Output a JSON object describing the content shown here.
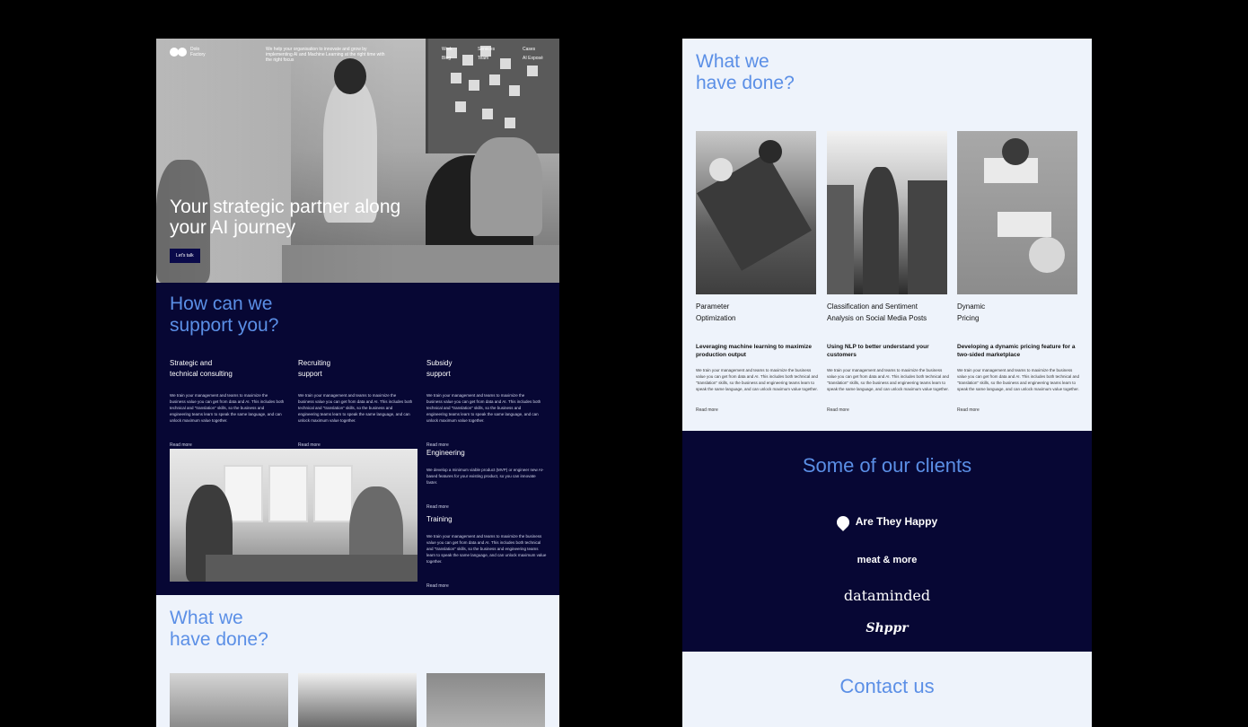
{
  "left": {
    "logo": {
      "line1": "Dolo",
      "line2": "Factory"
    },
    "hero": {
      "blurb": "We help your organisation to innovate and grow by implementing AI and Machine Learning at the right time with the right focus",
      "nav": [
        "Work",
        "Services",
        "Cases",
        "Blog",
        "Team",
        "AI Exposé"
      ],
      "title": "Your strategic partner along your AI journey",
      "cta": "Let's talk"
    },
    "support": {
      "title_l1": "How can we",
      "title_l2": "support you?",
      "services": [
        {
          "l1": "Strategic and",
          "l2": "technical consulting",
          "body": "We train your management and teams to maximize the business value you can get from data and AI. This includes both technical and \"translation\" skills, so the business and engineering teams learn to speak the same language, and can unlock maximum value together.",
          "more": "Read more"
        },
        {
          "l1": "Recruiting",
          "l2": "support",
          "body": "We train your management and teams to maximize the business value you can get from data and AI. This includes both technical and \"translation\" skills, so the business and engineering teams learn to speak the same language, and can unlock maximum value together.",
          "more": "Read more"
        },
        {
          "l1": "Subsidy",
          "l2": "support",
          "body": "We train your management and teams to maximize the business value you can get from data and AI. This includes both technical and \"translation\" skills, so the business and engineering teams learn to speak the same language, and can unlock maximum value together.",
          "more": "Read more"
        }
      ],
      "engineering": {
        "title": "Engineering",
        "body": "We develop a minimum viable product (MVP) or engineer new AI-based features for your existing product, so you can innovate faster.",
        "more": "Read more"
      },
      "training": {
        "title": "Training",
        "body": "We train your management and teams to maximize the business value you can get from data and AI. This includes both technical and \"translation\" skills, so the business and engineering teams learn to speak the same language, and can unlock maximum value together.",
        "more": "Read more"
      }
    },
    "done": {
      "title_l1": "What we",
      "title_l2": "have done?"
    }
  },
  "right": {
    "done": {
      "title_l1": "What we",
      "title_l2": "have done?",
      "cards": [
        {
          "t1": "Parameter",
          "t2": "Optimization",
          "sub": "Leveraging machine learning to maximize production output",
          "body": "We train your management and teams to maximize the business value you can get from data and AI. This includes both technical and \"translation\" skills, so the business and engineering teams learn to speak the same language, and can unlock maximum value together.",
          "more": "Read more"
        },
        {
          "t1": "Classification and Sentiment",
          "t2": "Analysis on Social Media Posts",
          "sub": "Using NLP to better understand your customers",
          "body": "We train your management and teams to maximize the business value you can get from data and AI. This includes both technical and \"translation\" skills, so the business and engineering teams learn to speak the same language, and can unlock maximum value together.",
          "more": "Read more"
        },
        {
          "t1": "Dynamic",
          "t2": "Pricing",
          "sub": "Developing a dynamic pricing feature for a two-sided marketplace",
          "body": "We train your management and teams to maximize the business value you can get from data and AI. This includes both technical and \"translation\" skills, so the business and engineering teams learn to speak the same language, and can unlock maximum value together.",
          "more": "Read more"
        }
      ]
    },
    "clients": {
      "title": "Some of our clients",
      "logos": [
        "Are They Happy",
        "meat & more",
        "dataminded",
        "Shppr"
      ]
    },
    "contact": {
      "title": "Contact us"
    }
  },
  "colors": {
    "navy": "#070734",
    "accent": "#5b8fe6",
    "light": "#eef3fb",
    "page_bg": "#000000"
  }
}
